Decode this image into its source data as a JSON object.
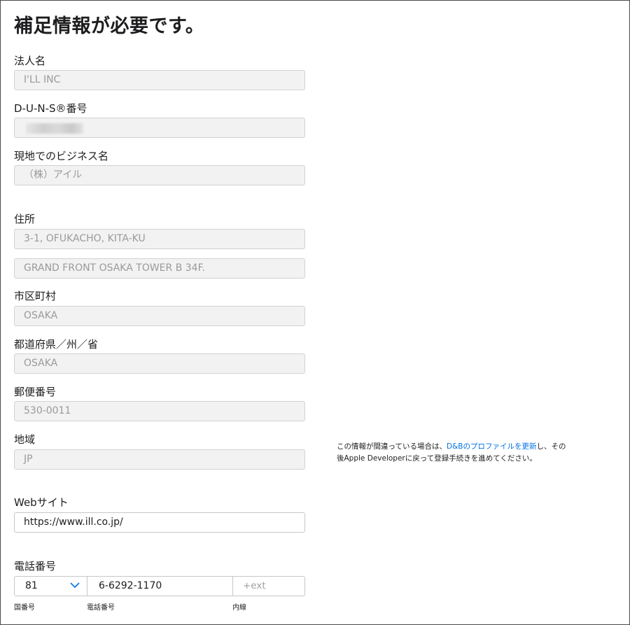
{
  "page": {
    "title": "補足情報が必要です。"
  },
  "fields": {
    "legal_name": {
      "label": "法人名",
      "value": "I'LL INC"
    },
    "duns": {
      "label": "D-U-N-S®番号",
      "value": ""
    },
    "local_business_name": {
      "label": "現地でのビジネス名",
      "value": "（株）アイル"
    },
    "address": {
      "label": "住所",
      "line1": "3-1, OFUKACHO, KITA-KU",
      "line2": "GRAND FRONT OSAKA TOWER B 34F."
    },
    "city": {
      "label": "市区町村",
      "value": "OSAKA"
    },
    "state": {
      "label": "都道府県／州／省",
      "value": "OSAKA"
    },
    "postal_code": {
      "label": "郵便番号",
      "value": "530-0011"
    },
    "region": {
      "label": "地域",
      "value": "JP"
    },
    "website": {
      "label": "Webサイト",
      "value": "https://www.ill.co.jp/"
    },
    "phone": {
      "label": "電話番号",
      "country_code": "81",
      "number": "6-6292-1170",
      "ext_placeholder": "+ext",
      "country_code_label": "国番号",
      "number_label": "電話番号",
      "ext_label": "内線"
    }
  },
  "note": {
    "text_before": "この情報が間違っている場合は、",
    "link": "D&Bのプロファイルを更新",
    "text_after_line1": "し、その",
    "text_line2": "後Apple Developerに戻って登録手続きを進めてください。"
  },
  "colors": {
    "link": "#0071e3",
    "disabled_field_bg": "#f2f2f2",
    "field_border": "#d2d2d7",
    "chevron": "#0071e3"
  },
  "icons": {
    "country_code_dropdown": "chevron-down-icon",
    "duns_redaction": "blurred-redaction"
  }
}
